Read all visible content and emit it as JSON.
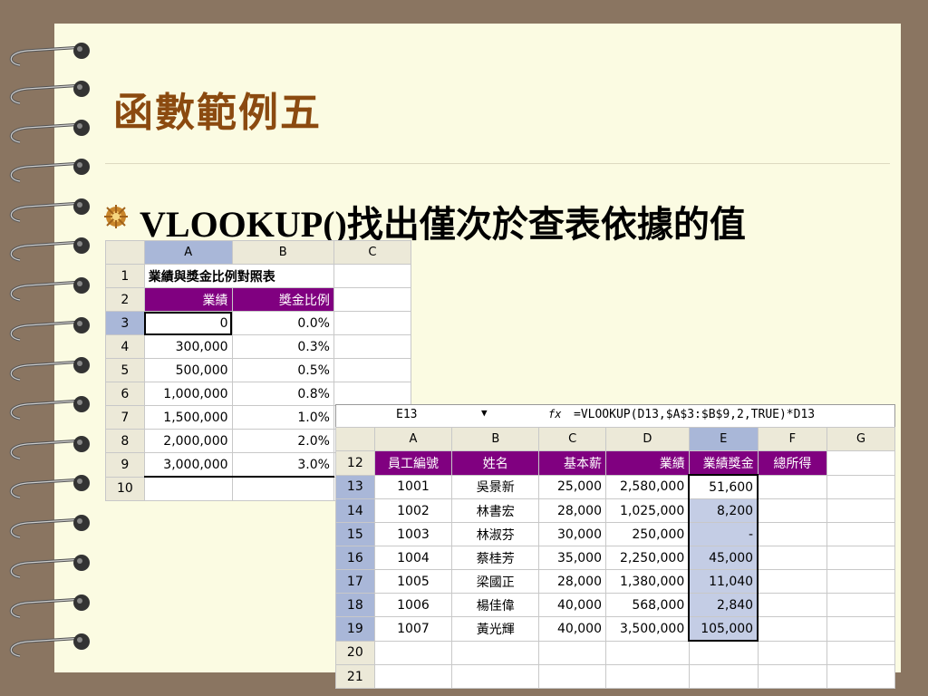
{
  "slide": {
    "title": "函數範例五",
    "bullet": "VLOOKUP()找出僅次於查表依據的值"
  },
  "table1": {
    "cols": [
      "A",
      "B",
      "C"
    ],
    "title": "業績與獎金比例對照表",
    "header": [
      "業績",
      "獎金比例"
    ],
    "rows": [
      {
        "n": "1"
      },
      {
        "n": "2"
      },
      {
        "n": "3",
        "a": "0",
        "b": "0.0%"
      },
      {
        "n": "4",
        "a": "300,000",
        "b": "0.3%"
      },
      {
        "n": "5",
        "a": "500,000",
        "b": "0.5%"
      },
      {
        "n": "6",
        "a": "1,000,000",
        "b": "0.8%"
      },
      {
        "n": "7",
        "a": "1,500,000",
        "b": "1.0%"
      },
      {
        "n": "8",
        "a": "2,000,000",
        "b": "2.0%"
      },
      {
        "n": "9",
        "a": "3,000,000",
        "b": "3.0%"
      },
      {
        "n": "10"
      }
    ]
  },
  "formula_bar": {
    "cell_ref": "E13",
    "fx": "fx",
    "formula": "=VLOOKUP(D13,$A$3:$B$9,2,TRUE)*D13"
  },
  "table2": {
    "cols": [
      "A",
      "B",
      "C",
      "D",
      "E",
      "F",
      "G"
    ],
    "header_row": "12",
    "header": [
      "員工編號",
      "姓名",
      "基本薪",
      "業績",
      "業績獎金",
      "總所得"
    ],
    "rows": [
      {
        "n": "13",
        "c": [
          "1001",
          "吳景新",
          "25,000",
          "2,580,000",
          "51,600"
        ]
      },
      {
        "n": "14",
        "c": [
          "1002",
          "林書宏",
          "28,000",
          "1,025,000",
          "8,200"
        ]
      },
      {
        "n": "15",
        "c": [
          "1003",
          "林淑芬",
          "30,000",
          "250,000",
          "-"
        ]
      },
      {
        "n": "16",
        "c": [
          "1004",
          "蔡桂芳",
          "35,000",
          "2,250,000",
          "45,000"
        ]
      },
      {
        "n": "17",
        "c": [
          "1005",
          "梁國正",
          "28,000",
          "1,380,000",
          "11,040"
        ]
      },
      {
        "n": "18",
        "c": [
          "1006",
          "楊佳偉",
          "40,000",
          "568,000",
          "2,840"
        ]
      },
      {
        "n": "19",
        "c": [
          "1007",
          "黃光輝",
          "40,000",
          "3,500,000",
          "105,000"
        ]
      }
    ],
    "empty_rows": [
      "20",
      "21"
    ]
  }
}
